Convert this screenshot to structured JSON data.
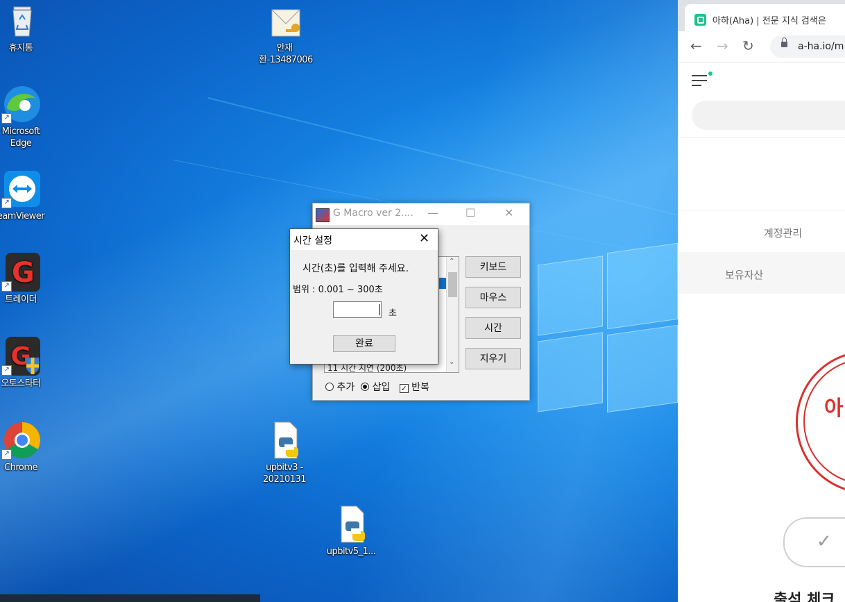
{
  "desktop": {
    "icons": [
      {
        "label": "휴지통",
        "icon": "recycle-bin-icon"
      },
      {
        "label": "Microsoft Edge",
        "icon": "edge-icon"
      },
      {
        "label": "eamViewer",
        "icon": "teamviewer-icon"
      },
      {
        "label": "트레이더",
        "icon": "g-trader-icon"
      },
      {
        "label": "오토스타터",
        "icon": "g-autostarter-icon"
      },
      {
        "label": "Chrome",
        "icon": "chrome-icon"
      },
      {
        "label": "안재환-13487006",
        "icon": "mail-key-file-icon"
      },
      {
        "label": "upbitv3 - 20210131",
        "icon": "python-file-icon"
      },
      {
        "label": "upbitv5_1...",
        "icon": "python-file-icon"
      }
    ]
  },
  "gmacro": {
    "title": "G Macro  ver 2....",
    "buttons": {
      "keyboard": "키보드",
      "mouse": "마우스",
      "time": "시간",
      "erase": "지우기"
    },
    "list_partial_item": "11    시간 지연 (200초)",
    "options": {
      "add": "추가",
      "insert": "삽입",
      "repeat": "반복",
      "selected": "삽입",
      "repeat_checked": true
    }
  },
  "dialog": {
    "title": "시간 설정",
    "prompt": "시간(초)를 입력해 주세요.",
    "range": "범위 : 0.001 ~ 300초",
    "input_value": "",
    "unit": "초",
    "ok_label": "완료"
  },
  "browser": {
    "tab_title": "아하(Aha) | 전문 지식 검색은",
    "url": "a-ha.io/m",
    "nav_account": "계정관리",
    "nav_assets": "보유자산",
    "stamp_text": "아",
    "bottom_text": "출석 체크",
    "accent_color": "#1ec28b",
    "stamp_color": "#d9312d"
  }
}
